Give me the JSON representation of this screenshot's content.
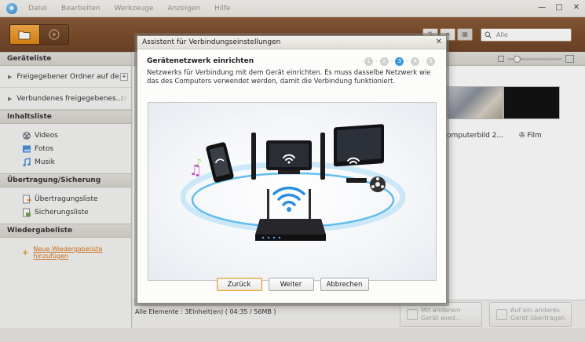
{
  "menu": [
    "Datei",
    "Bearbeiten",
    "Werkzeuge",
    "Anzeigen",
    "Hilfe"
  ],
  "window_controls": {
    "minimize": "—",
    "maximize": "□",
    "close": "✕"
  },
  "toolbar": {
    "search_placeholder": "Alle"
  },
  "sidebar": {
    "devices_header": "Geräteliste",
    "devices": [
      {
        "label": "Freigegebener Ordner auf de..."
      },
      {
        "label": "Verbundenes freigegebenes..."
      }
    ],
    "content_header": "Inhaltsliste",
    "content_items": [
      {
        "label": "Videos",
        "icon": "film-reel-icon"
      },
      {
        "label": "Fotos",
        "icon": "photo-icon"
      },
      {
        "label": "Musik",
        "icon": "music-note-icon"
      }
    ],
    "transfer_header": "Übertragung/Sicherung",
    "transfer_items": [
      {
        "label": "Übertragungsliste",
        "icon": "transfer-list-icon"
      },
      {
        "label": "Sicherungsliste",
        "icon": "backup-list-icon"
      }
    ],
    "playlist_header": "Wiedergabeliste",
    "playlist_add": "Neue Wiedergabeliste hinzufügen"
  },
  "content": {
    "thumb_labels": [
      "omputerbild 2...",
      "Film"
    ],
    "status": "Alle Elemente : 3Einheit(en) ( 04:35 / 56MB )",
    "action_buttons": [
      {
        "line1": "Mit anderem",
        "line2": "Gerät wied..."
      },
      {
        "line1": "Auf ein anderes",
        "line2": "Gerät übertragen"
      }
    ]
  },
  "dialog": {
    "title": "Assistent für Verbindungseinstellungen",
    "close": "✕",
    "heading": "Gerätenetzwerk einrichten",
    "steps": [
      "1",
      "2",
      "3",
      "4",
      "5"
    ],
    "current_step": 3,
    "text": "Netzwerks für Verbindung mit dem Gerät einrichten. Es muss dasselbe Netzwerk wie das des Computers verwendet werden, damit die Verbindung funktioniert.",
    "buttons": {
      "back": "Zurück",
      "next": "Weiter",
      "cancel": "Abbrechen"
    }
  },
  "colors": {
    "accent_orange": "#de8616",
    "step_active": "#3a9ad9",
    "wood": "#7a4c2b",
    "link_orange": "#d9761c"
  }
}
